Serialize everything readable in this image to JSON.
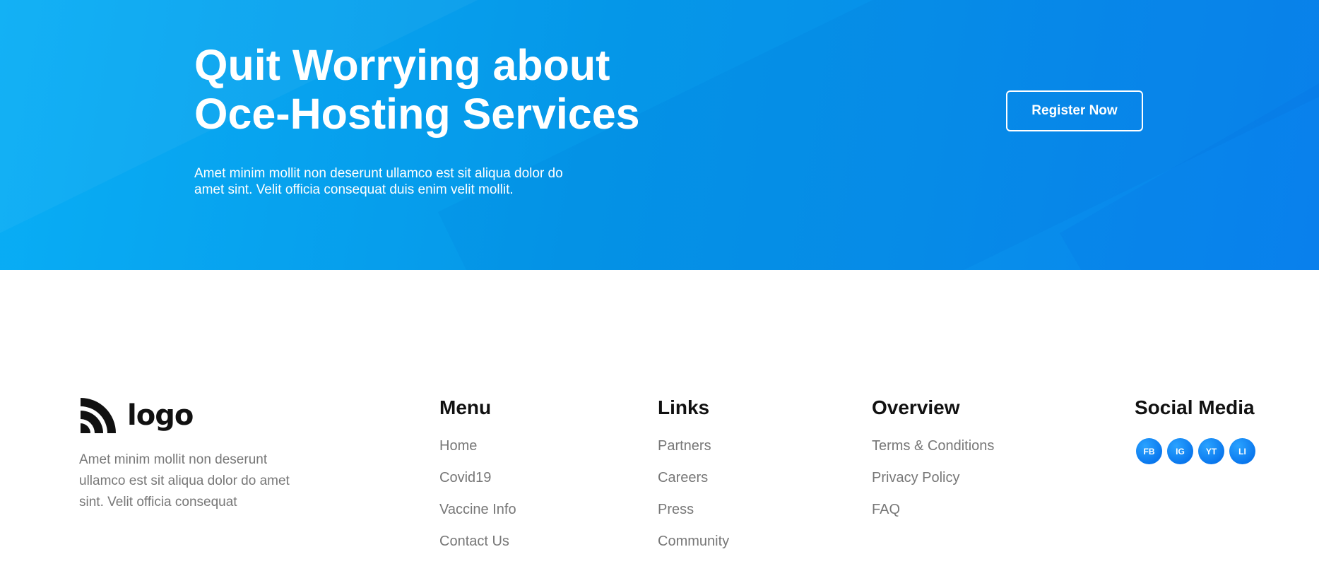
{
  "hero": {
    "title_line1": "Quit Worrying about",
    "title_line2": "Oce-Hosting Services",
    "description": "Amet minim mollit non deserunt ullamco est sit aliqua dolor do amet sint. Velit officia consequat duis enim velit mollit.",
    "register_label": "Register Now",
    "colors": {
      "gradient_start": "#09aef5",
      "gradient_end": "#0a84ee"
    }
  },
  "footer": {
    "brand": {
      "logo_text": "logo",
      "logo_icon": "signal-arcs-icon",
      "description": "Amet minim mollit non deserunt ullamco est sit aliqua dolor do amet sint. Velit officia consequat"
    },
    "menu": {
      "title": "Menu",
      "items": [
        "Home",
        "Covid19",
        "Vaccine Info",
        "Contact Us"
      ]
    },
    "links": {
      "title": "Links",
      "items": [
        "Partners",
        "Careers",
        "Press",
        "Community"
      ]
    },
    "overview": {
      "title": "Overview",
      "items": [
        "Terms & Conditions",
        "Privacy Policy",
        "FAQ"
      ]
    },
    "social": {
      "title": "Social Media",
      "icons": [
        {
          "label": "FB",
          "icon": "facebook-icon"
        },
        {
          "label": "IG",
          "icon": "instagram-icon"
        },
        {
          "label": "YT",
          "icon": "youtube-icon"
        },
        {
          "label": "LI",
          "icon": "linkedin-icon"
        }
      ],
      "color": "#0a78ee"
    }
  }
}
